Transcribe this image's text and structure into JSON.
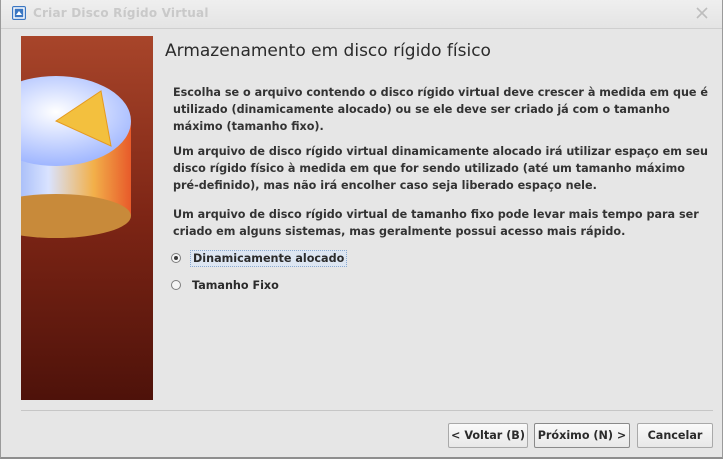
{
  "window": {
    "title": "Criar Disco Rígido Virtual"
  },
  "page": {
    "heading": "Armazenamento em disco rígido físico",
    "paragraphs": [
      "Escolha se o arquivo contendo o disco rígido virtual deve crescer à medida em que é utilizado (dinamicamente alocado) ou se ele deve ser criado já com o tamanho máximo (tamanho fixo).",
      "Um arquivo de disco rígido virtual dinamicamente alocado irá utilizar espaço em seu disco rígido físico à medida em que for sendo utilizado (até um tamanho máximo pré-definido), mas não irá encolher caso seja liberado espaço nele.",
      "Um arquivo de disco rígido virtual de tamanho fixo pode levar mais tempo para ser criado em alguns sistemas, mas geralmente possui acesso mais rápido."
    ],
    "options": [
      {
        "label": "Dinamicamente alocado",
        "checked": true
      },
      {
        "label": "Tamanho Fixo",
        "checked": false
      }
    ]
  },
  "buttons": {
    "back": "< Voltar (B)",
    "next": "Próximo (N) >",
    "cancel": "Cancelar"
  },
  "icons": {
    "title": "virtualbox-icon",
    "close": "close-icon",
    "side": "disk-pie-illustration"
  }
}
